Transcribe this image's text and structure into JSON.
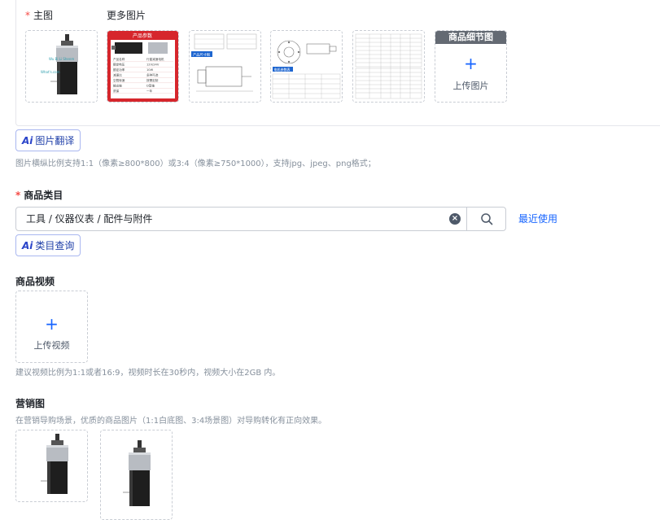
{
  "main_images": {
    "main_label": "主图",
    "more_label": "更多图片",
    "detail_slot": {
      "header": "商品细节图",
      "plus": "+",
      "upload_text": "上传图片"
    },
    "thumb1": {
      "wm1": "Wu Bi Li Shenm",
      "wm2": "What's.com"
    },
    "thumb2": {
      "title": "产品参数",
      "rows": [
        {
          "k": "产品名称",
          "v": "行星减速电机"
        },
        {
          "k": "额定电压",
          "v": "12V/24V"
        },
        {
          "k": "额定功率",
          "v": "10W"
        },
        {
          "k": "减速比",
          "v": "多种可选"
        },
        {
          "k": "空载转速",
          "v": "按需定制"
        },
        {
          "k": "输出轴",
          "v": "D型轴"
        },
        {
          "k": "质保",
          "v": "一年"
        }
      ]
    },
    "thumb3": {
      "tag": "产品尺寸图"
    },
    "thumb4": {
      "tag": "电机参数表"
    }
  },
  "translate_button": {
    "ai": "Ai",
    "label": "图片翻译"
  },
  "image_hint": "图片横纵比例支持1:1（像素≥800*800）或3:4（像素≥750*1000），支持jpg、jpeg、png格式；",
  "category": {
    "title": "商品类目",
    "value": "工具 / 仪器仪表 / 配件与附件",
    "clear": "×",
    "recent": "最近使用"
  },
  "category_query_button": {
    "ai": "Ai",
    "label": "类目查询"
  },
  "video": {
    "title": "商品视频",
    "plus": "+",
    "upload_text": "上传视频",
    "hint": "建议视频比例为1:1或者16:9，视频时长在30秒内，视频大小在2GB 内。"
  },
  "marketing": {
    "title": "营销图",
    "hint": "在营销导购场景，优质的商品图片（1:1白底图、3:4场景图）对导购转化有正向效果。"
  },
  "colors": {
    "accent": "#1664ff",
    "required": "#f54a45",
    "red_banner": "#d6262c"
  }
}
